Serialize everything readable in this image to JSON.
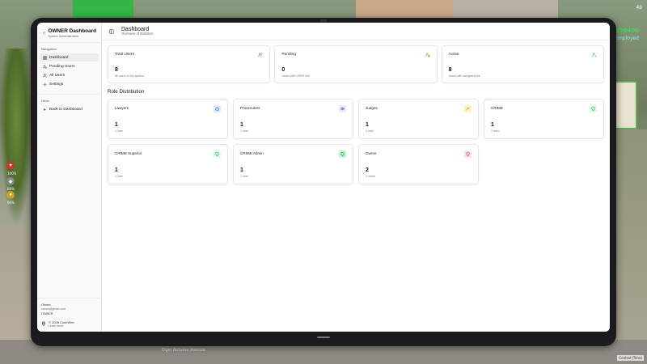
{
  "hud": {
    "top_right_line": "49",
    "money": "$50400",
    "money_secondary": "Employed",
    "status_pcts": [
      "100%",
      "60%",
      "90%"
    ],
    "street": "Elgin Autumn Avenue",
    "corner_label": "Central (Trine)"
  },
  "sidebar": {
    "brand_title": "OWNER Dashboard",
    "brand_subtitle": "System Administration",
    "nav_label": "Navigation",
    "items": [
      {
        "label": "Dashboard",
        "icon": "dashboard-icon"
      },
      {
        "label": "Pending Users",
        "icon": "user-clock-icon"
      },
      {
        "label": "All Users",
        "icon": "users-icon"
      },
      {
        "label": "Settings",
        "icon": "gear-icon"
      }
    ],
    "other_label": "Other",
    "other_items": [
      {
        "label": "Back to Dashboard",
        "icon": "arrow-left-icon"
      }
    ],
    "user": {
      "name": "Owner",
      "email": "owner@gmail.com",
      "role": "OWNER"
    },
    "credit": {
      "line1": "© 2026 CodeWeb",
      "line2": "Learn more"
    }
  },
  "header": {
    "title": "Dashboard",
    "subtitle": "Overview of statistics"
  },
  "stats": [
    {
      "label": "Total Users",
      "value": "8",
      "desc": "All users in the system",
      "icon": "users-icon",
      "color": "#6b7280"
    },
    {
      "label": "Pending",
      "value": "0",
      "desc": "Users with USER role",
      "icon": "user-clock-icon",
      "color": "#d97706"
    },
    {
      "label": "Active",
      "value": "8",
      "desc": "Users with assigned role",
      "icon": "user-check-icon",
      "color": "#16a34a"
    }
  ],
  "roles_title": "Role Distribution",
  "roles": [
    {
      "name": "Lawyers",
      "count": "1",
      "users": "1 user",
      "icon": "briefcase-icon",
      "bg": "#dbeafe",
      "fg": "#2563eb"
    },
    {
      "name": "Prosecutors",
      "count": "1",
      "users": "1 user",
      "icon": "eye-icon",
      "bg": "#ede9fe",
      "fg": "#7c3aed"
    },
    {
      "name": "Judges",
      "count": "1",
      "users": "1 user",
      "icon": "gavel-icon",
      "bg": "#fef3c7",
      "fg": "#ca8a04"
    },
    {
      "name": "CRIME",
      "count": "1",
      "users": "1 user",
      "icon": "shield-icon",
      "bg": "#dcfce7",
      "fg": "#16a34a"
    },
    {
      "name": "CRIME Superior",
      "count": "1",
      "users": "1 user",
      "icon": "shield-icon",
      "bg": "#dcfce7",
      "fg": "#16a34a"
    },
    {
      "name": "CRIME Admin",
      "count": "1",
      "users": "1 user",
      "icon": "shield-icon",
      "bg": "#bbf7d0",
      "fg": "#15803d"
    },
    {
      "name": "Owner",
      "count": "2",
      "users": "2 users",
      "icon": "shield-icon",
      "bg": "#fee2e2",
      "fg": "#dc2626"
    }
  ]
}
